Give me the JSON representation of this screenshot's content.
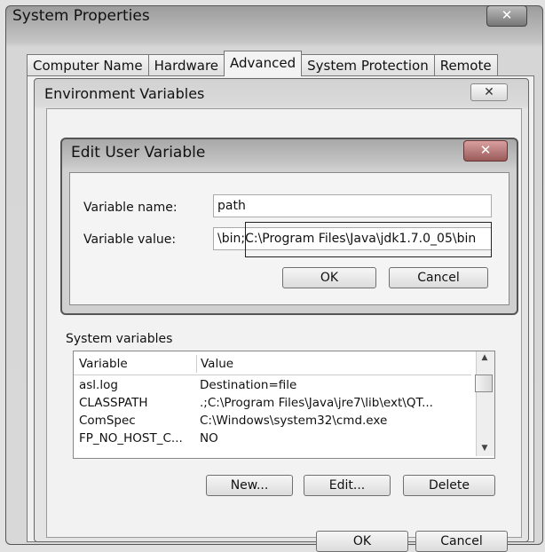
{
  "system_properties": {
    "title": "System Properties",
    "close_glyph": "✕",
    "tabs": [
      "Computer Name",
      "Hardware",
      "Advanced",
      "System Protection",
      "Remote"
    ],
    "active_tab": "Advanced"
  },
  "environment_variables": {
    "title": "Environment Variables",
    "close_glyph": "✕",
    "system_variables_label": "System variables",
    "columns": [
      "Variable",
      "Value"
    ],
    "rows": [
      {
        "variable": "asl.log",
        "value": "Destination=file"
      },
      {
        "variable": "CLASSPATH",
        "value": ".;C:\\Program Files\\Java\\jre7\\lib\\ext\\QT..."
      },
      {
        "variable": "ComSpec",
        "value": "C:\\Windows\\system32\\cmd.exe"
      },
      {
        "variable": "FP_NO_HOST_C...",
        "value": "NO"
      }
    ],
    "buttons": {
      "new": "New...",
      "edit": "Edit...",
      "delete": "Delete",
      "ok": "OK",
      "cancel": "Cancel"
    }
  },
  "edit_user_variable": {
    "title": "Edit User Variable",
    "close_glyph": "✕",
    "variable_name_label": "Variable name:",
    "variable_value_label": "Variable value:",
    "variable_name": "path",
    "variable_value": "\\bin;C:\\Program Files\\Java\\jdk1.7.0_05\\bin",
    "ok_label": "OK",
    "cancel_label": "Cancel"
  }
}
